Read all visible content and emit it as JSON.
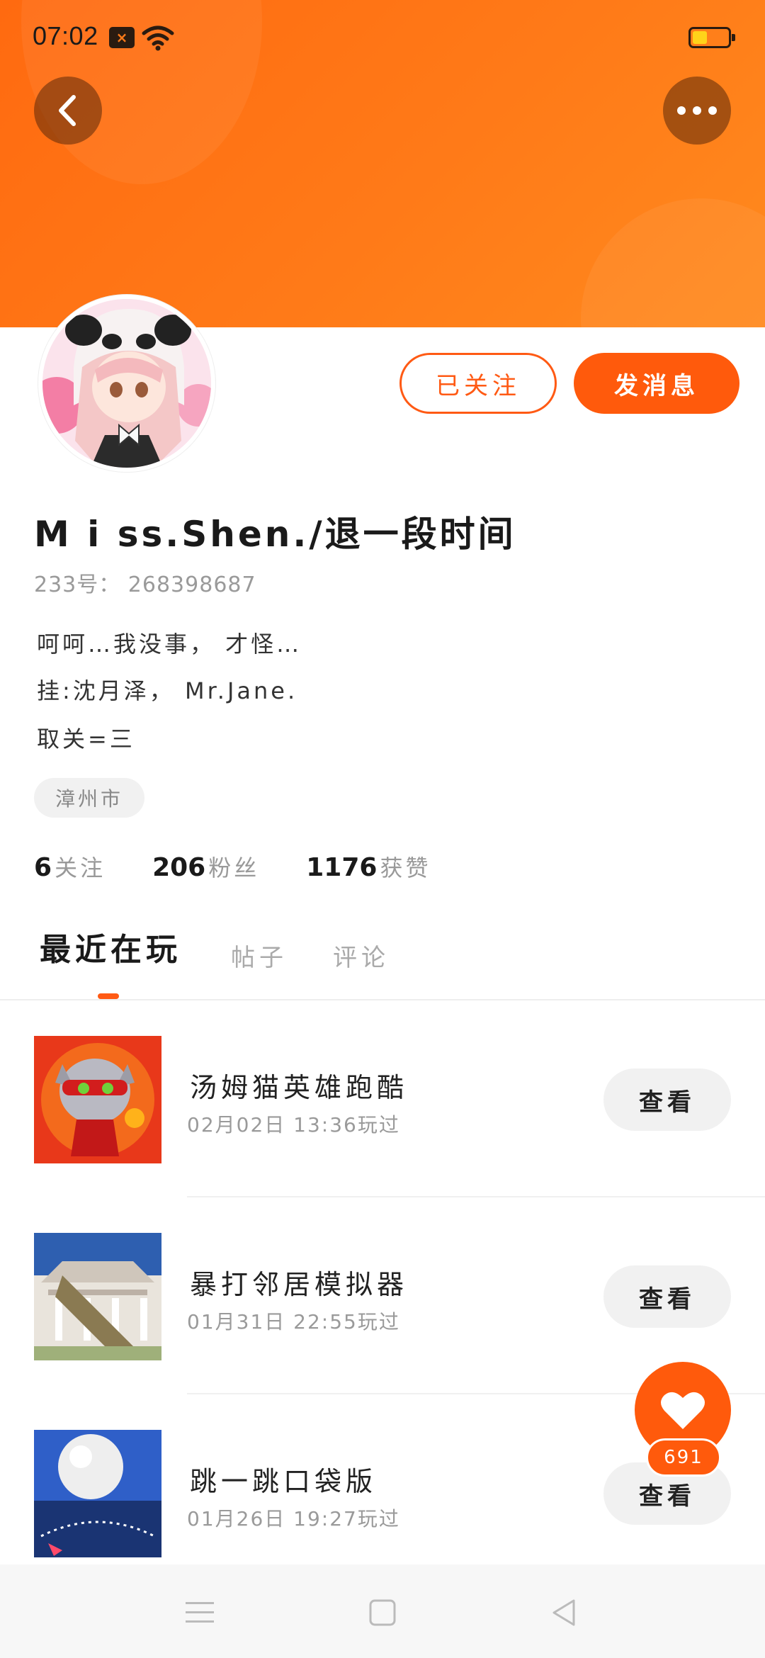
{
  "status_bar": {
    "time": "07:02"
  },
  "profile": {
    "username": "M i ss.Shen./退一段时间",
    "id_text": "233号： 268398687",
    "bio": [
      "呵呵…我没事， 才怪…",
      "挂:沈月泽， Mr.Jane.",
      "取关=三"
    ],
    "location": "漳州市",
    "follow_button": "已关注",
    "message_button": "发消息"
  },
  "stats": [
    {
      "value": "6",
      "label": "关注"
    },
    {
      "value": "206",
      "label": "粉丝"
    },
    {
      "value": "1176",
      "label": "获赞"
    }
  ],
  "tabs": [
    "最近在玩",
    "帖子",
    "评论"
  ],
  "games": [
    {
      "title": "汤姆猫英雄跑酷",
      "time": "02月02日 13:36玩过",
      "button": "查看"
    },
    {
      "title": "暴打邻居模拟器",
      "time": "01月31日 22:55玩过",
      "button": "查看"
    },
    {
      "title": "跳一跳口袋版",
      "time": "01月26日 19:27玩过",
      "button": "查看"
    }
  ],
  "like": {
    "count": "691"
  },
  "colors": {
    "accent": "#ff5a0c",
    "banner": "#ff7a18"
  },
  "icons": {
    "back": "back-arrow-icon",
    "more": "more-dots-icon",
    "like": "heart-icon"
  }
}
